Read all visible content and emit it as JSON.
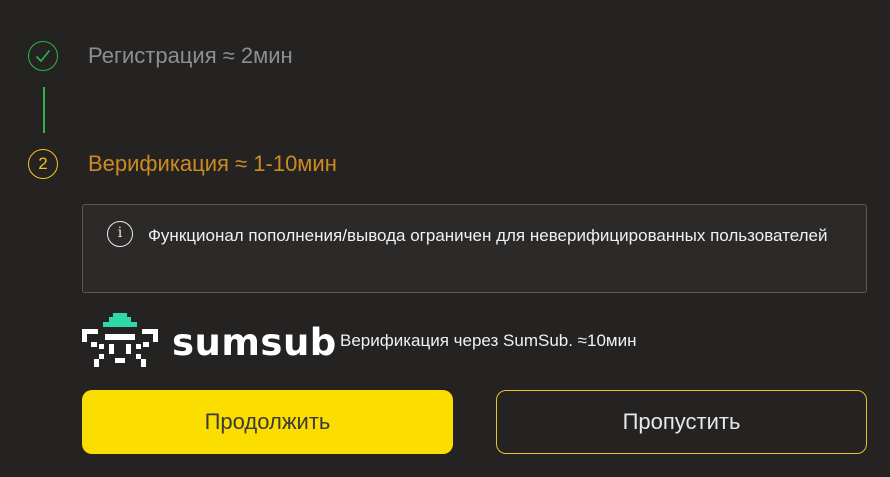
{
  "steps": [
    {
      "label": "Регистрация ≈ 2мин",
      "status": "done",
      "icon": "check-icon",
      "color": "#2fb34a"
    },
    {
      "number": "2",
      "label": "Верификация ≈ 1-10мин",
      "status": "active",
      "color": "#f2c41a"
    }
  ],
  "notice": {
    "icon": "info-icon",
    "text": "Функционал пополнения/вывода ограничен для неверифицированных пользователей"
  },
  "sumsub": {
    "logo_text": "sumsub",
    "caption": "Верификация через SumSub. ≈10мин",
    "accent": "#2ed8a8"
  },
  "buttons": {
    "continue_label": "Продолжить",
    "skip_label": "Пропустить",
    "primary_color": "#fcdd00"
  }
}
